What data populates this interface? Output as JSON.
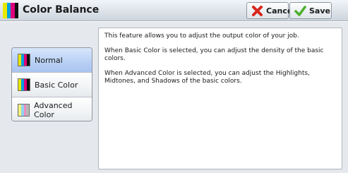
{
  "header": {
    "title": "Color Balance",
    "cancel_label": "Cancel",
    "save_label": "Save"
  },
  "modes": [
    {
      "label": "Normal",
      "selected": true
    },
    {
      "label": "Basic Color",
      "selected": false
    },
    {
      "label": "Advanced Color",
      "selected": false
    }
  ],
  "description": [
    "This feature allows you to adjust the output color of your job.",
    "When Basic Color is selected, you can adjust the density of the basic colors.",
    "When Advanced Color is selected, you can adjust the Highlights, Midtones, and Shadows of the basic colors."
  ],
  "colors": {
    "selected_item": "#b9d0f5",
    "cancel_icon": "#d9261c",
    "save_icon": "#4caf2a"
  },
  "icons": {
    "title": "color-bars-icon",
    "cancel": "x-icon",
    "save": "checkmark-icon"
  }
}
